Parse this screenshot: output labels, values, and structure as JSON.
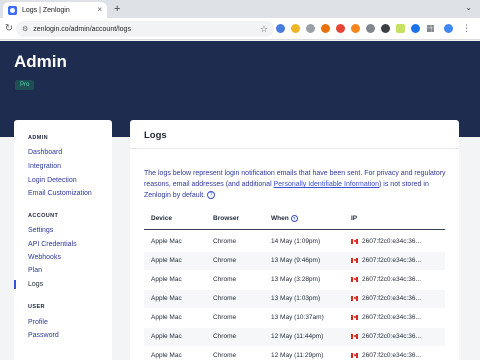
{
  "browser": {
    "tab_title": "Logs | Zenlogin",
    "tab_close": "×",
    "new_tab": "+",
    "url": "zenlogin.co/admin/account/logs",
    "icons": [
      "back-arrow-icon",
      "refresh-icon",
      "site-settings-icon",
      "bookmark-star-icon",
      "extensions-puzzle-icon",
      "profile-avatar-icon",
      "kebab-menu-icon"
    ],
    "nav": {
      "back": "←",
      "reload": "↻",
      "star": "☆",
      "tune": "⚙",
      "puzzle": "▦",
      "menu": "⋮",
      "window_menu": "⌄"
    }
  },
  "header": {
    "title": "Admin",
    "plan_badge": "Pro"
  },
  "sidebar": {
    "sections": [
      {
        "heading": "ADMIN",
        "items": [
          "Dashboard",
          "Integration",
          "Login Detection",
          "Email Customization"
        ]
      },
      {
        "heading": "ACCOUNT",
        "items": [
          "Settings",
          "API Credentials",
          "Webhooks",
          "Plan",
          "Logs"
        ]
      },
      {
        "heading": "USER",
        "items": [
          "Profile",
          "Password"
        ]
      }
    ],
    "active_item": "Logs"
  },
  "main": {
    "title": "Logs",
    "description_before": "The logs below represent login notification emails that have been sent. For privacy and regulatory reasons, email addresses (and additional ",
    "description_link": "Personally Identifiable Information",
    "description_after": ") is not stored in Zenlogin by default.",
    "help_glyph": "?",
    "columns": [
      "Device",
      "Browser",
      "When",
      "IP"
    ],
    "rows": [
      {
        "device": "Apple Mac",
        "browser": "Chrome",
        "when": "14 May (1:09pm)",
        "ip": "2607:f2c0:e34c:36..."
      },
      {
        "device": "Apple Mac",
        "browser": "Chrome",
        "when": "13 May (9:46pm)",
        "ip": "2607:f2c0:e34c:36..."
      },
      {
        "device": "Apple Mac",
        "browser": "Chrome",
        "when": "13 May (3:28pm)",
        "ip": "2607:f2c0:e34c:36..."
      },
      {
        "device": "Apple Mac",
        "browser": "Chrome",
        "when": "13 May (1:03pm)",
        "ip": "2607:f2c0:e34c:36..."
      },
      {
        "device": "Apple Mac",
        "browser": "Chrome",
        "when": "13 May (10:37am)",
        "ip": "2607:f2c0:e34c:36..."
      },
      {
        "device": "Apple Mac",
        "browser": "Chrome",
        "when": "12 May (11:44pm)",
        "ip": "2607:f2c0:e34c:36..."
      },
      {
        "device": "Apple Mac",
        "browser": "Chrome",
        "when": "12 May (11:29pm)",
        "ip": "2607:f2c0:e34c:36..."
      }
    ]
  },
  "colors": {
    "header_bg": "#1e2c4f",
    "accent": "#3b50d6",
    "badge_text": "#57d6a8",
    "flag_red": "#d52b1e"
  }
}
